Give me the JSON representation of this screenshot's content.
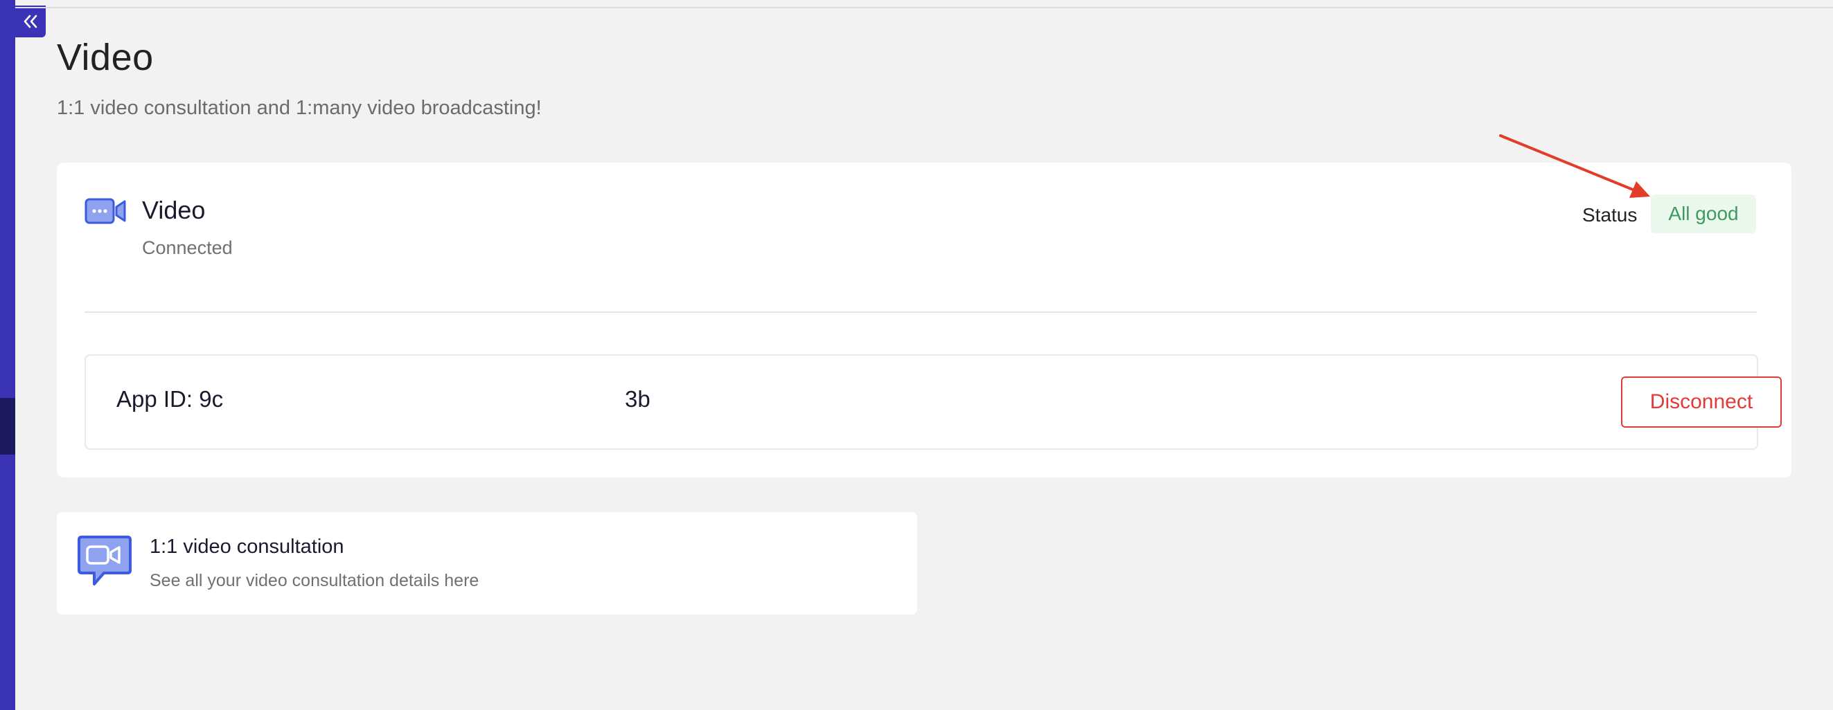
{
  "page": {
    "title": "Video",
    "subtitle": "1:1 video consultation and 1:many video broadcasting!"
  },
  "sidebar": {
    "collapse_icon": "double-chevron-left-icon"
  },
  "integration_card": {
    "icon": "video-camera-icon",
    "title": "Video",
    "connection_state": "Connected",
    "status_label": "Status",
    "status_value": "All good",
    "status_color": "#3f9a5e",
    "app_id_prefix": "App ID: 9c",
    "app_id_suffix": "3b",
    "disconnect_label": "Disconnect",
    "danger_color": "#e03a3a"
  },
  "consultation_card": {
    "icon": "video-chat-icon",
    "title": "1:1 video consultation",
    "description": "See all your video consultation details here"
  },
  "colors": {
    "sidebar": "#3a33b5",
    "accent_icon": "#3d5be0",
    "annotation_arrow": "#e23d28"
  }
}
